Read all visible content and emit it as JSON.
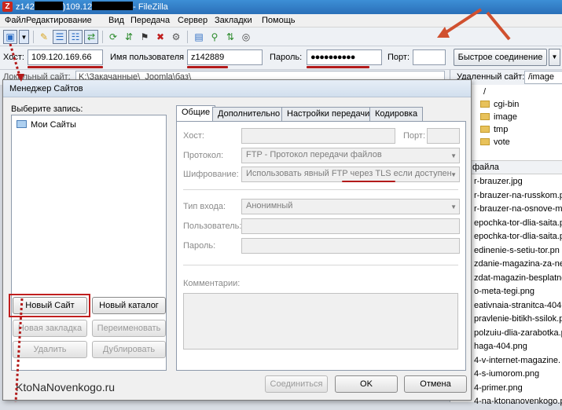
{
  "window": {
    "title": "109.120.169.66 - FileZilla",
    "title_visible": "z142        )109.12          - FileZilla",
    "app_icon": "Z",
    "prefix": "z142",
    "host_part": ")109.12",
    "suffix": "- FileZilla"
  },
  "menu": [
    "Файл",
    "Редактирование",
    "Вид",
    "Передача",
    "Сервер",
    "Закладки",
    "Помощь"
  ],
  "quickconnect": {
    "host_label": "Хост:",
    "host_value": "109.120.169.66",
    "user_label": "Имя пользователя",
    "user_value": "z142889",
    "pass_label": "Пароль:",
    "pass_value": "●●●●●●●●●●",
    "port_label": "Порт:",
    "port_value": "",
    "connect_button": "Быстрое соединение"
  },
  "local_site": {
    "label": "Локальный сайт:",
    "value": "K:\\Закачанные\\_Joomla\\баз\\"
  },
  "remote": {
    "label": "Удаленный сайт:",
    "path": "/image",
    "tree": [
      "/",
      "cgi-bin",
      "image",
      "tmp",
      "vote"
    ],
    "files_header": "файла",
    "files": [
      "r-brauzer.jpg",
      "r-brauzer-na-russkom.p",
      "r-brauzer-na-osnove-m",
      "epochka-tor-dlia-saita.p",
      "epochka-tor-dlia-saita.p",
      "edinenie-s-setiu-tor.pn",
      "zdanie-magazina-za-ne",
      "zdat-magazin-besplatno",
      "o-meta-tegi.png",
      "eativnaia-stranitca-404-",
      "pravlenie-bitikh-ssilok.p",
      "polzuiu-dlia-zarabotka.p",
      "haga-404.png",
      "4-v-internet-magazine.",
      "4-s-iumorom.png",
      "4-primer.png",
      "4-na-ktonanovenkogo.p"
    ]
  },
  "dialog": {
    "title": "Менеджер Сайтов",
    "select_label": "Выберите запись:",
    "tree_root": "Мои Сайты",
    "buttons": {
      "new_site": "Новый Сайт",
      "new_folder": "Новый каталог",
      "new_bookmark": "Новая закладка",
      "rename": "Переименовать",
      "delete": "Удалить",
      "duplicate": "Дублировать",
      "connect": "Соединиться",
      "ok": "OK",
      "cancel": "Отмена"
    },
    "tabs": [
      "Общие",
      "Дополнительно",
      "Настройки передачи",
      "Кодировка"
    ],
    "fields": {
      "host_label": "Хост:",
      "port_label": "Порт:",
      "protocol_label": "Протокол:",
      "protocol_value": "FTP - Протокол передачи файлов",
      "encryption_label": "Шифрование:",
      "encryption_value": "Использовать явный FTP через TLS если доступен",
      "login_type_label": "Тип входа:",
      "login_type_value": "Анонимный",
      "user_label": "Пользователь:",
      "password_label": "Пароль:",
      "comments_label": "Комментарии:"
    }
  },
  "watermark": "KtoNaNovenkogo.ru",
  "colors": {
    "annotation_red": "#b31b1b",
    "arrow_red": "#d0502f"
  }
}
